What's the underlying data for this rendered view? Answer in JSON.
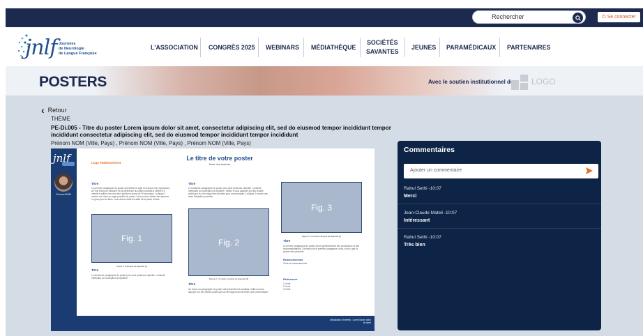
{
  "header": {
    "search_placeholder": "Rechercher",
    "logout_label": "Se connecter"
  },
  "brand": {
    "name": "jnlf",
    "subtitle_line1": "Journées",
    "subtitle_line2": "de Neurologie",
    "subtitle_line3": "de Langue Française"
  },
  "nav": {
    "items": [
      {
        "label": "L'ASSOCIATION"
      },
      {
        "label": "CONGRÈS 2025"
      },
      {
        "label": "WEBINARS"
      },
      {
        "label": "MÉDIATHÈQUE"
      },
      {
        "label": "SOCIÉTÉS",
        "label2": "SAVANTES"
      },
      {
        "label": "JEUNES"
      },
      {
        "label": "PARAMÉDICAUX"
      },
      {
        "label": "PARTENAIRES"
      }
    ]
  },
  "banner": {
    "title": "POSTERS",
    "support_text": "Avec le soutien institutionnel de",
    "logo_text": "LOGO"
  },
  "main": {
    "back_label": "Retour",
    "theme_label": "THÈME",
    "poster_title": "PE-Di.005 - Titre du poster Lorem ipsum dolor sit amet, consectetur adipiscing elit, sed do eiusmod tempor incididunt tempor incididunt consectetur adipiscing elit, sed do eiusmod tempor incididunt tempor incididunt",
    "authors": "Prénom NOM (Ville, Pays) , Prénom NOM (Ville, Pays) , Prénom NOM (Ville, Pays)"
  },
  "poster": {
    "sidebar_logo": "jnlf",
    "presenter_name": "Prénom NOM",
    "establishment_logo": "Logo établissement",
    "title": "Le titre de votre poster",
    "authors": "Nom des auteurs",
    "col1": {
      "title1": "Titre",
      "text1": "Le premier paragraphe du poster doit définir le sujet et résumer son importance. Un bon test pour s'assurer de la pertinence du poster consiste à vérifier s'il oriente le public vers ses deux points en moins de 30 secondes. La figure 1 montre une mise en page possible du poster. Vous pouvez utiliser des phrases en gras pour les titres, vous devez réduire la taille de la police du titre.",
      "fig": "Fig. 1",
      "caption": "Figure 1. Exemple de légende [1]",
      "title2": "Titre",
      "text2": "Le deuxième paragraphe du poster peut avoir plusieurs objectifs : contexte, méthodes ou conception du système."
    },
    "col2": {
      "title1": "Titre",
      "text1": "Le troisième paragraphe du poster peut avoir plusieurs objectifs : contexte, méthodes ou conception du système. Veillez à vous appuyer sur des visuels plutôt que sur de longs blocs de texte pour communiquer. La figure 2 montre une autre illustration possible.",
      "fig": "Fig. 2",
      "caption": "Figure 2. Un autre exemple de légende [1]",
      "title2": "Titre",
      "text2": "Au moins un paragraphe du poster doit présenter les résultats. Veillez à vous appuyer sur des visuels plutôt que sur de longs blocs de texte pour communiquer."
    },
    "col3": {
      "fig": "Fig. 3",
      "caption": "Figure 3. Un autre exemple de légende [1]",
      "title1": "Titre",
      "text1": "Le dernier paragraphe du poster fournit généralement des conclusions et des recommandations. Comme pour le premier paragraphe, celui-ci est lu par la plupart des passants.",
      "thanks_title": "Remerciements",
      "thanks_text": "Texte de remerciements",
      "refs_title": "Références",
      "ref1": "1. texte",
      "ref2": "2. texte",
      "ref3": "3. texte"
    },
    "footer": "Déclaration d'intérêts : Lorem ipsum dolor sit amet"
  },
  "comments": {
    "title": "Commentaires",
    "input_placeholder": "Ajouter un commentaire",
    "items": [
      {
        "author": "Rahul Sethi -10:07",
        "text": "Merci"
      },
      {
        "author": "Jean-Claude Mateli -10:07",
        "text": "Intéressant"
      },
      {
        "author": "Rahul Sethi -10:07",
        "text": "Très bien"
      }
    ]
  },
  "colors": {
    "navy": "#1b2a4e",
    "accent_orange": "#e56f1f",
    "poster_blue": "#1a3c72"
  }
}
